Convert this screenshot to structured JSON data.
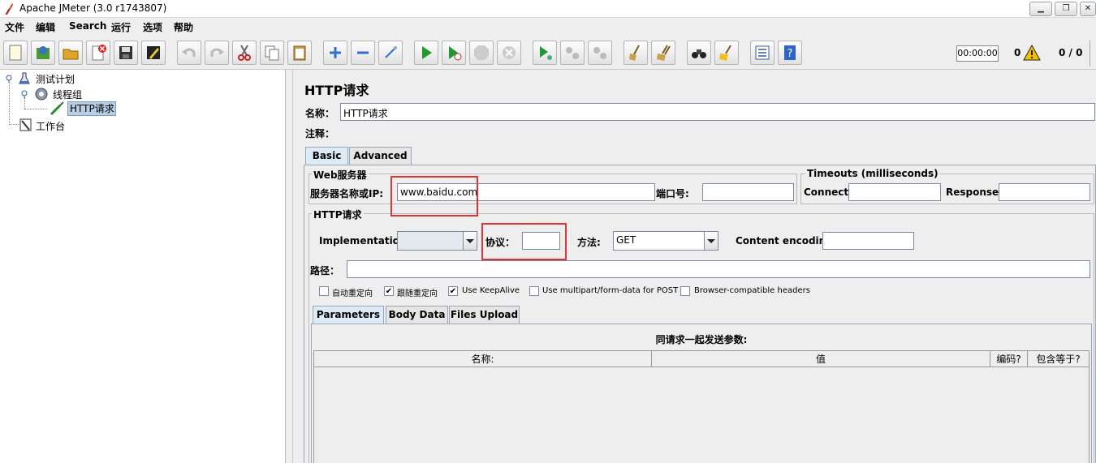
{
  "window": {
    "title": "Apache JMeter (3.0 r1743807)"
  },
  "menu": [
    "文件",
    "编辑",
    "Search",
    "运行",
    "选项",
    "帮助"
  ],
  "toolbar": {
    "timer": "00:00:00",
    "error_count": "0",
    "thread_count": "0 / 0"
  },
  "tree": {
    "test_plan": "测试计划",
    "thread_group": "线程组",
    "http_request": "HTTP请求",
    "workbench": "工作台"
  },
  "sampler": {
    "header": "HTTP请求",
    "name_label": "名称：",
    "name_value": "HTTP请求",
    "comment_label": "注释：",
    "comment_value": "",
    "tabs": [
      "Basic",
      "Advanced"
    ],
    "web_server": {
      "title": "Web服务器",
      "server_label": "服务器名称或IP:",
      "server_value": "www.baidu.com",
      "port_label": "端口号:",
      "port_value": ""
    },
    "timeouts": {
      "title": "Timeouts (milliseconds)",
      "connect_label": "Connect:",
      "connect_value": "",
      "response_label": "Response:",
      "response_value": ""
    },
    "http_request": {
      "title": "HTTP请求",
      "implementation_label": "Implementation:",
      "implementation_value": "",
      "protocol_label": "协议：",
      "protocol_value": "",
      "method_label": "方法:",
      "method_value": "GET",
      "encoding_label": "Content encoding:",
      "encoding_value": "",
      "path_label": "路径：",
      "path_value": ""
    },
    "options": [
      {
        "label": "自动重定向",
        "checked": false
      },
      {
        "label": "跟随重定向",
        "checked": true
      },
      {
        "label": "Use KeepAlive",
        "checked": true
      },
      {
        "label": "Use multipart/form-data for POST",
        "checked": false
      },
      {
        "label": "Browser-compatible headers",
        "checked": false
      }
    ],
    "param_tabs": [
      "Parameters",
      "Body Data",
      "Files Upload"
    ],
    "params_caption": "同请求一起发送参数:",
    "columns": [
      "名称:",
      "值",
      "编码?",
      "包含等于?"
    ]
  },
  "colors": {
    "highlight_box": "#e03434",
    "selected_tree": "#b8cfe5"
  }
}
